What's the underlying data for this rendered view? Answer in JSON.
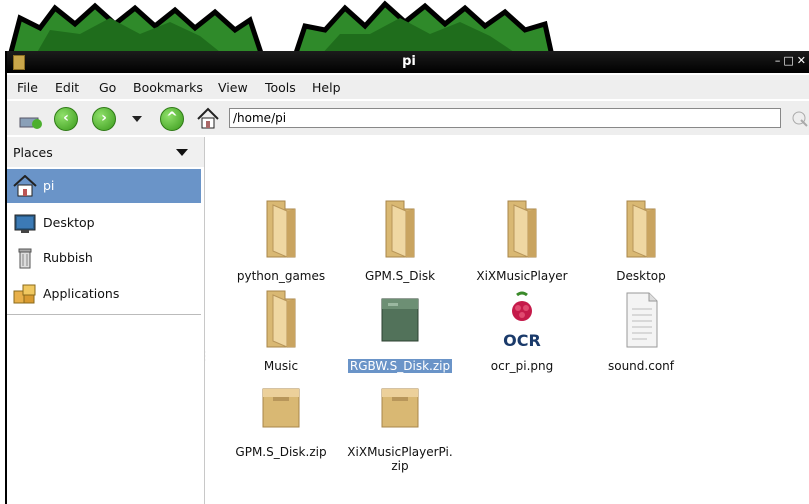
{
  "window": {
    "title": "pi"
  },
  "menu": [
    "File",
    "Edit",
    "Go",
    "Bookmarks",
    "View",
    "Tools",
    "Help"
  ],
  "toolbar": {
    "path": "/home/pi"
  },
  "sidebar": {
    "header": "Places",
    "items": [
      {
        "label": "pi",
        "icon": "home-icon",
        "selected": true
      },
      {
        "label": "Desktop",
        "icon": "desktop-icon"
      },
      {
        "label": "Rubbish",
        "icon": "trash-icon"
      },
      {
        "label": "Applications",
        "icon": "applications-icon"
      }
    ]
  },
  "files": [
    {
      "label": "python_games",
      "icon": "folder-icon"
    },
    {
      "label": "GPM.S_Disk",
      "icon": "folder-icon"
    },
    {
      "label": "XiXMusicPlayer",
      "icon": "folder-icon"
    },
    {
      "label": "Desktop",
      "icon": "folder-icon"
    },
    {
      "label": "Music",
      "icon": "folder-icon"
    },
    {
      "label": "RGBW.S_Disk.zip",
      "icon": "archive-icon",
      "selected": true
    },
    {
      "label": "ocr_pi.png",
      "icon": "image-icon"
    },
    {
      "label": "sound.conf",
      "icon": "text-file-icon"
    },
    {
      "label": "GPM.S_Disk.zip",
      "icon": "archive-icon"
    },
    {
      "label": "XiXMusicPlayerPi.zip",
      "icon": "archive-icon"
    }
  ],
  "ocr_logo_text": "OCR"
}
